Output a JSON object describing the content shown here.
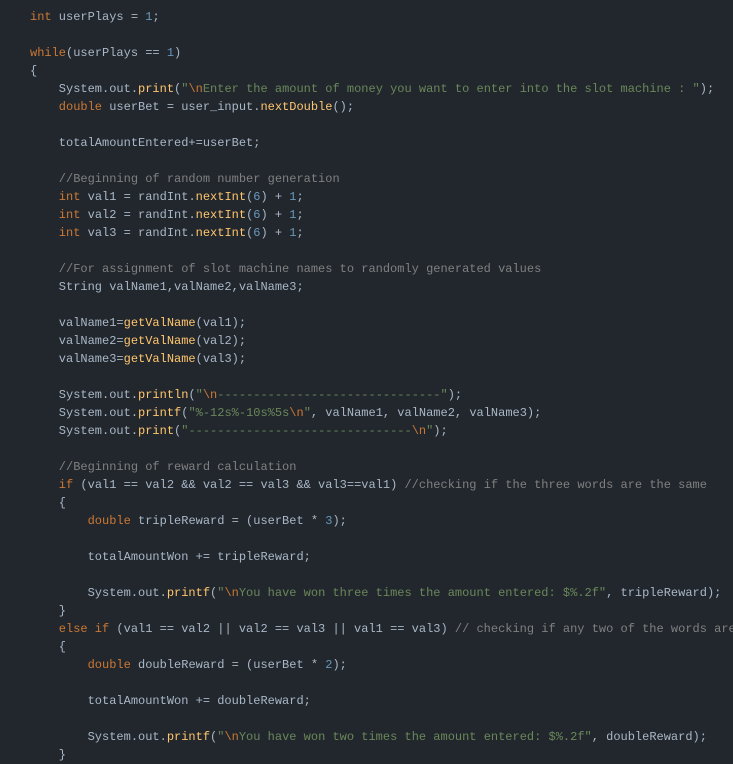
{
  "code": {
    "l1": {
      "kw_int": "int",
      "ident": " userPlays = ",
      "num": "1",
      "semi": ";"
    },
    "l3": {
      "kw_while": "while",
      "open": "(userPlays == ",
      "num": "1",
      "close": ")"
    },
    "l4": {
      "brace": "{"
    },
    "l5": {
      "obj": "    System.out.",
      "method": "print",
      "open": "(",
      "str1": "\"",
      "esc1": "\\n",
      "str2": "Enter the amount of money you want to enter into the slot machine : \"",
      "close": ");"
    },
    "l6": {
      "kw": "    double",
      "ident": " userBet = user_input.",
      "method": "nextDouble",
      "end": "();"
    },
    "l8": {
      "text": "    totalAmountEntered+=userBet;"
    },
    "l10": {
      "comment": "    //Beginning of random number generation"
    },
    "l11": {
      "kw": "    int",
      "ident": " val1 = randInt.",
      "method": "nextInt",
      "open": "(",
      "num1": "6",
      "mid": ") + ",
      "num2": "1",
      "semi": ";"
    },
    "l12": {
      "kw": "    int",
      "ident": " val2 = randInt.",
      "method": "nextInt",
      "open": "(",
      "num1": "6",
      "mid": ") + ",
      "num2": "1",
      "semi": ";"
    },
    "l13": {
      "kw": "    int",
      "ident": " val3 = randInt.",
      "method": "nextInt",
      "open": "(",
      "num1": "6",
      "mid": ") + ",
      "num2": "1",
      "semi": ";"
    },
    "l15": {
      "comment": "    //For assignment of slot machine names to randomly generated values"
    },
    "l16": {
      "text": "    String valName1,valName2,valName3;"
    },
    "l18": {
      "ident": "    valName1=",
      "method": "getValName",
      "end": "(val1);"
    },
    "l19": {
      "ident": "    valName2=",
      "method": "getValName",
      "end": "(val2);"
    },
    "l20": {
      "ident": "    valName3=",
      "method": "getValName",
      "end": "(val3);"
    },
    "l22": {
      "obj": "    System.out.",
      "method": "println",
      "open": "(",
      "str1": "\"",
      "esc1": "\\n",
      "str2": "-------------------------------\"",
      "close": ");"
    },
    "l23": {
      "obj": "    System.out.",
      "method": "printf",
      "open": "(",
      "str": "\"%-12s%-10s%5s",
      "esc": "\\n",
      "strend": "\"",
      "rest": ", valName1, valName2, valName3);"
    },
    "l24": {
      "obj": "    System.out.",
      "method": "print",
      "open": "(",
      "str": "\"-------------------------------",
      "esc": "\\n",
      "strend": "\"",
      "close": ");"
    },
    "l26": {
      "comment": "    //Beginning of reward calculation"
    },
    "l27": {
      "kw": "    if",
      "cond": " (val1 == val2 && val2 == val3 && val3==val1) ",
      "comment": "//checking if the three words are the same"
    },
    "l28": {
      "brace": "    {"
    },
    "l29": {
      "kw": "        double",
      "ident": " tripleReward = (userBet * ",
      "num": "3",
      "end": ");"
    },
    "l31": {
      "text": "        totalAmountWon += tripleReward;"
    },
    "l33": {
      "obj": "        System.out.",
      "method": "printf",
      "open": "(",
      "str1": "\"",
      "esc1": "\\n",
      "str2": "You have won three times the amount entered: $%.2f\"",
      "rest": ", tripleReward);"
    },
    "l34": {
      "brace": "    }"
    },
    "l35": {
      "kw1": "    else if",
      "cond": " (val1 == val2 || val2 == val3 || val1 == val3) ",
      "comment": "// checking if any two of the words are same"
    },
    "l36": {
      "brace": "    {"
    },
    "l37": {
      "kw": "        double",
      "ident": " doubleReward = (userBet * ",
      "num": "2",
      "end": ");"
    },
    "l39": {
      "text": "        totalAmountWon += doubleReward;"
    },
    "l41": {
      "obj": "        System.out.",
      "method": "printf",
      "open": "(",
      "str1": "\"",
      "esc1": "\\n",
      "str2": "You have won two times the amount entered: $%.2f\"",
      "rest": ", doubleReward);"
    },
    "l42": {
      "brace": "    }"
    }
  }
}
